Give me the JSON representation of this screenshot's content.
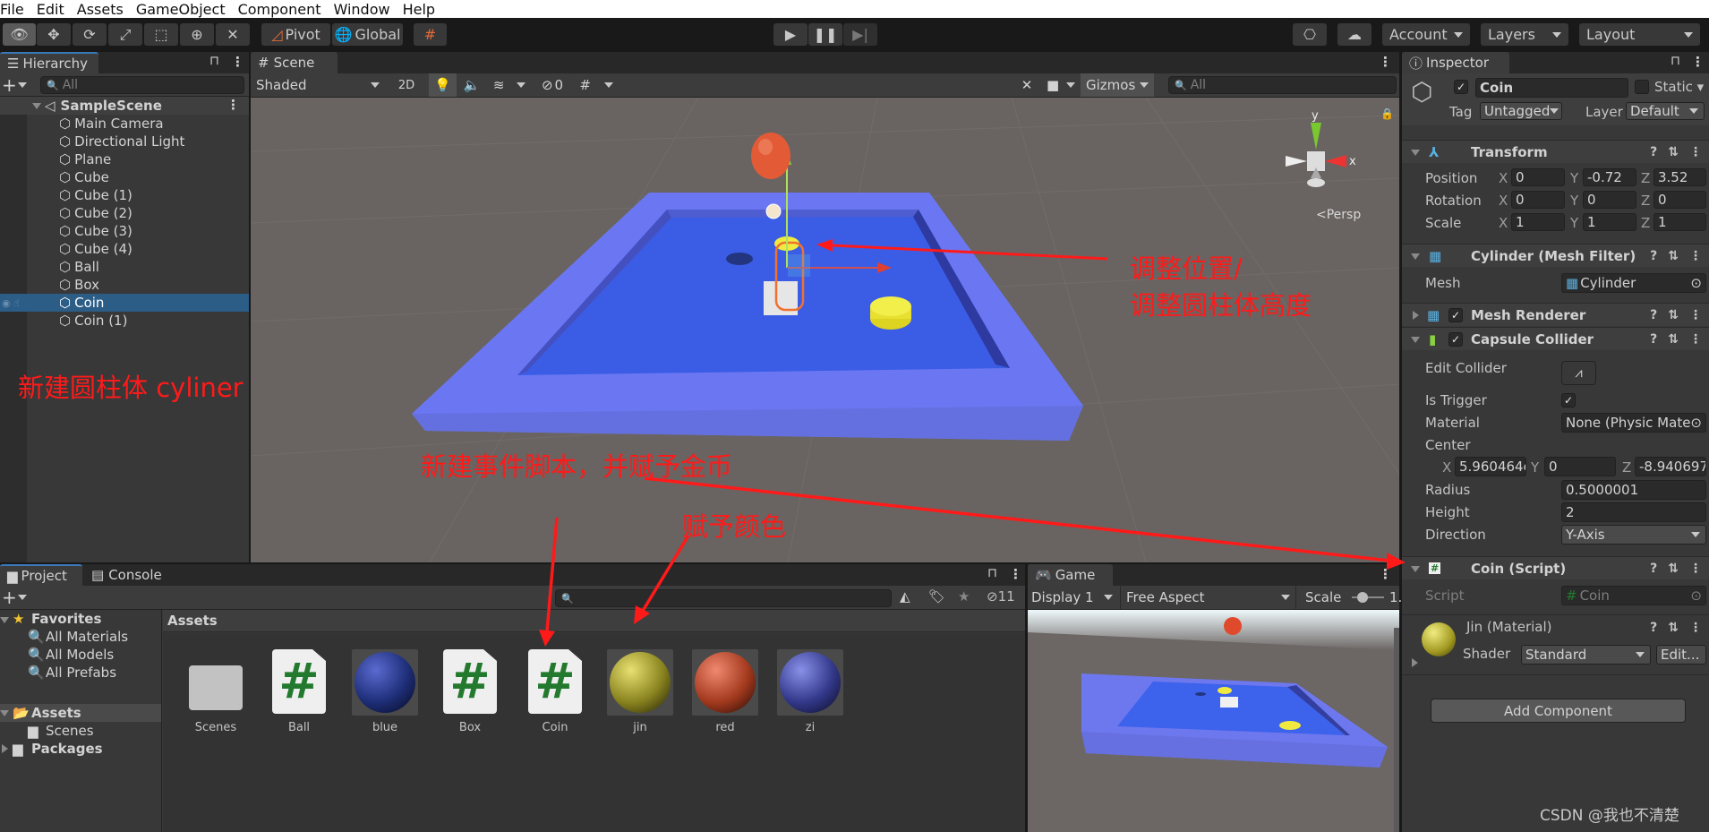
{
  "menu": [
    "File",
    "Edit",
    "Assets",
    "GameObject",
    "Component",
    "Window",
    "Help"
  ],
  "toolbar": {
    "tools": [
      "view-tool",
      "move-tool",
      "rotate-tool",
      "scale-tool",
      "rect-tool",
      "transform-tool",
      "custom-tool"
    ],
    "pivot_label": "Pivot",
    "global_label": "Global",
    "account_label": "Account",
    "layers_label": "Layers",
    "layout_label": "Layout"
  },
  "hierarchy": {
    "tab_label": "Hierarchy",
    "search_placeholder": "All",
    "scene_name": "SampleScene",
    "items": [
      "Main Camera",
      "Directional Light",
      "Plane",
      "Cube",
      "Cube (1)",
      "Cube (2)",
      "Cube (3)",
      "Cube (4)",
      "Ball",
      "Box",
      "Coin",
      "Coin (1)"
    ],
    "selected": "Coin"
  },
  "scene": {
    "tab_label": "Scene",
    "shading_mode": "Shaded",
    "mode_2d": "2D",
    "hidden_count": "0",
    "gizmos_label": "Gizmos",
    "search_placeholder": "All",
    "projection_label": "Persp",
    "axis_x": "x",
    "axis_y": "y"
  },
  "annotations": {
    "create_cylinder": "新建圆柱体 cyliner",
    "adjust_line1": "调整位置/",
    "adjust_line2": "调整圆柱体高度",
    "create_script": "新建事件脚本，并赋予金币",
    "assign_color": "赋予颜色",
    "colors": {
      "annotation": "#ff1a1a"
    }
  },
  "inspector": {
    "tab_label": "Inspector",
    "object_name": "Coin",
    "active": true,
    "static_label": "Static",
    "tag_label": "Tag",
    "tag_value": "Untagged",
    "layer_label": "Layer",
    "layer_value": "Default",
    "transform": {
      "title": "Transform",
      "position": {
        "label": "Position",
        "x": "0",
        "y": "-0.72",
        "z": "3.52"
      },
      "rotation": {
        "label": "Rotation",
        "x": "0",
        "y": "0",
        "z": "0"
      },
      "scale": {
        "label": "Scale",
        "x": "1",
        "y": "1",
        "z": "1"
      }
    },
    "mesh_filter": {
      "title": "Cylinder (Mesh Filter)",
      "mesh_label": "Mesh",
      "mesh_value": "Cylinder"
    },
    "mesh_renderer": {
      "title": "Mesh Renderer",
      "enabled": true
    },
    "capsule_collider": {
      "title": "Capsule Collider",
      "enabled": true,
      "edit_collider_label": "Edit Collider",
      "is_trigger_label": "Is Trigger",
      "is_trigger": true,
      "material_label": "Material",
      "material_value": "None (Physic Mate",
      "center_label": "Center",
      "center": {
        "x": "5.960464e",
        "y": "0",
        "z": "-8.940697"
      },
      "radius_label": "Radius",
      "radius_value": "0.5000001",
      "height_label": "Height",
      "height_value": "2",
      "direction_label": "Direction",
      "direction_value": "Y-Axis"
    },
    "coin_script": {
      "title": "Coin (Script)",
      "script_label": "Script",
      "script_value": "Coin"
    },
    "material": {
      "title": "Jin (Material)",
      "shader_label": "Shader",
      "shader_value": "Standard",
      "edit_label": "Edit..."
    },
    "add_component_label": "Add Component",
    "axis_labels": {
      "x": "X",
      "y": "Y",
      "z": "Z"
    }
  },
  "project": {
    "tab_label": "Project",
    "console_tab_label": "Console",
    "hidden_count": "11",
    "favorites_label": "Favorites",
    "favorites": [
      "All Materials",
      "All Models",
      "All Prefabs"
    ],
    "assets_label": "Assets",
    "assets_children": [
      "Scenes"
    ],
    "packages_label": "Packages",
    "breadcrumb": "Assets",
    "assets": [
      {
        "name": "Scenes",
        "type": "folder"
      },
      {
        "name": "Ball",
        "type": "script"
      },
      {
        "name": "blue",
        "type": "material",
        "color": "#1e2e78"
      },
      {
        "name": "Box",
        "type": "script"
      },
      {
        "name": "Coin",
        "type": "script"
      },
      {
        "name": "jin",
        "type": "material",
        "color": "#8a8420"
      },
      {
        "name": "red",
        "type": "material",
        "color": "#a33a1e"
      },
      {
        "name": "zi",
        "type": "material",
        "color": "#33388a"
      }
    ]
  },
  "game": {
    "tab_label": "Game",
    "display": "Display 1",
    "aspect": "Free Aspect",
    "scale_label": "Scale",
    "scale_value": "1."
  },
  "watermark": "CSDN @我也不清楚"
}
